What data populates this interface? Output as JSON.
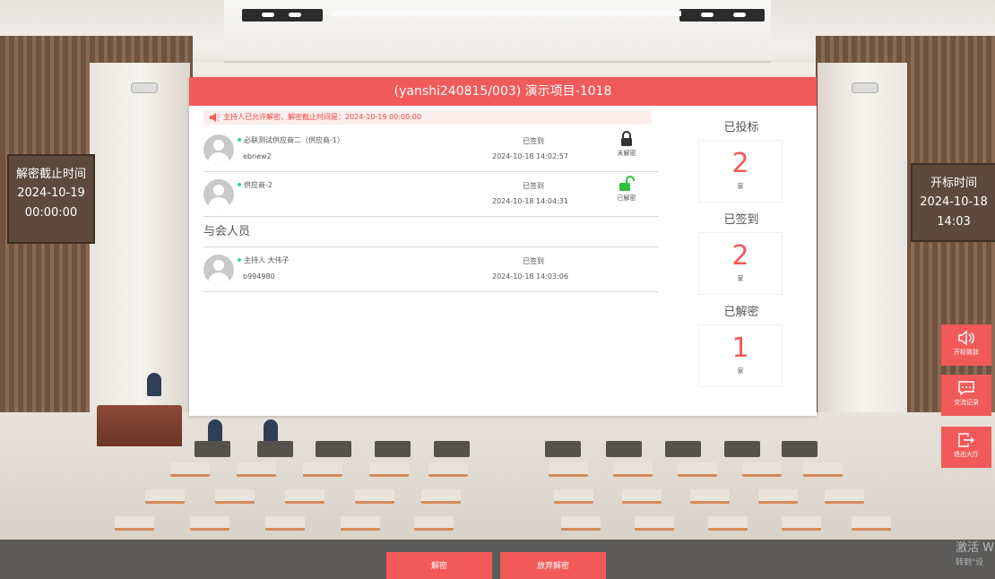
{
  "header": {
    "title": "(yanshi240815/003) 演示项目-1018"
  },
  "notice": {
    "text": "主持人已允许解密，解密截止时间是：2024-10-19 00:00:00"
  },
  "left_board": {
    "title": "解密截止时间",
    "date": "2024-10-19",
    "time": "00:00:00"
  },
  "right_board": {
    "title": "开标时间",
    "date": "2024-10-18",
    "time": "14:03"
  },
  "bidders": [
    {
      "name": "必联测试供应商二（供应商-1）",
      "user": "ebnew2",
      "status": "已签到",
      "time": "2024-10-18 14:02:57",
      "lock_label": "未解密",
      "locked": true
    },
    {
      "name": "供应商-2",
      "user": "",
      "status": "已签到",
      "time": "2024-10-18 14:04:31",
      "lock_label": "已解密",
      "locked": false
    }
  ],
  "attendees": {
    "title": "与会人员",
    "items": [
      {
        "name": "主持人 大伟子",
        "user": "b994980",
        "status": "已签到",
        "time": "2024-10-18 14:03:06"
      }
    ]
  },
  "stats": [
    {
      "label": "已投标",
      "value": "2",
      "unit": "家"
    },
    {
      "label": "已签到",
      "value": "2",
      "unit": "家"
    },
    {
      "label": "已解密",
      "value": "1",
      "unit": "家"
    }
  ],
  "actions": [
    {
      "label": "开标致辞",
      "icon": "speaker-icon"
    },
    {
      "label": "交流记录",
      "icon": "chat-icon"
    },
    {
      "label": "退出大厅",
      "icon": "exit-icon"
    }
  ],
  "buttons": {
    "decrypt": "解密",
    "abandon": "放弃解密"
  },
  "watermark": {
    "line1": "激活 W",
    "line2": "转到\"设"
  },
  "colors": {
    "accent": "#f25a5a",
    "locked": "#333333",
    "unlocked": "#2fbf3a",
    "online_dot": "#3ccf8e"
  }
}
